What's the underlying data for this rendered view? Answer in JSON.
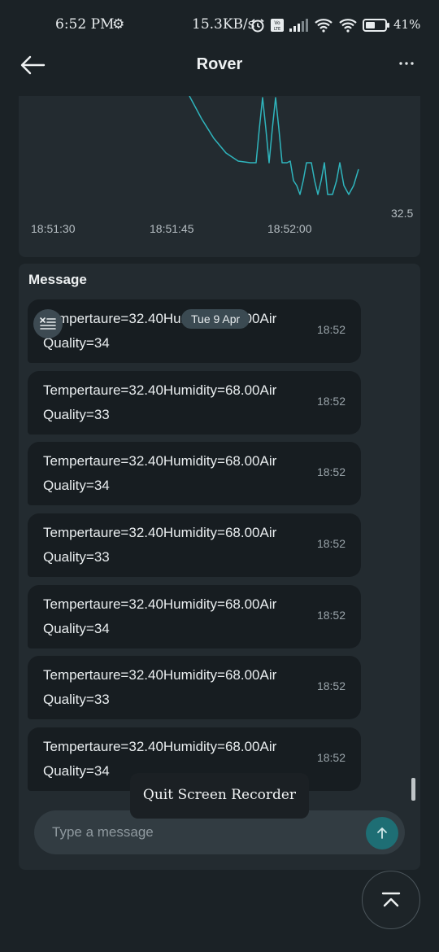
{
  "status_bar": {
    "time": "6:52 PM",
    "network_speed": "15.3KB/s",
    "battery": "41%"
  },
  "app_bar": {
    "title": "Rover"
  },
  "chart_data": {
    "type": "line",
    "x_ticks": [
      "18:51:30",
      "18:51:45",
      "18:52:00"
    ],
    "y_ticks": [
      "32.5"
    ],
    "series": [
      {
        "color": "#2fb5bd"
      }
    ]
  },
  "messages": {
    "heading": "Message",
    "date_pill": "Tue 9 Apr",
    "items": [
      {
        "text": "Tempertaure=32.40Humidity=68.00Air Quality=34",
        "time": "18:52"
      },
      {
        "text": "Tempertaure=32.40Humidity=68.00Air Quality=33",
        "time": "18:52"
      },
      {
        "text": "Tempertaure=32.40Humidity=68.00Air Quality=34",
        "time": "18:52"
      },
      {
        "text": "Tempertaure=32.40Humidity=68.00Air Quality=33",
        "time": "18:52"
      },
      {
        "text": "Tempertaure=32.40Humidity=68.00Air Quality=34",
        "time": "18:52"
      },
      {
        "text": "Tempertaure=32.40Humidity=68.00Air Quality=33",
        "time": "18:52"
      },
      {
        "text": "Tempertaure=32.40Humidity=68.00Air Quality=34",
        "time": "18:52"
      }
    ]
  },
  "composer": {
    "placeholder": "Type a message"
  },
  "toast": {
    "label": "Quit Screen Recorder"
  },
  "colors": {
    "background": "#1b2226",
    "card": "#232b30",
    "bubble": "#171d21",
    "accent": "#1e6e74",
    "chart_line": "#2fb5bd"
  },
  "icons": [
    "settings-icon",
    "alarm-icon",
    "volte-icon",
    "signal-icon",
    "wifi-icon",
    "battery-icon",
    "back-arrow-icon",
    "more-icon",
    "format-clear-icon",
    "send-arrow-icon",
    "scroll-top-icon"
  ]
}
